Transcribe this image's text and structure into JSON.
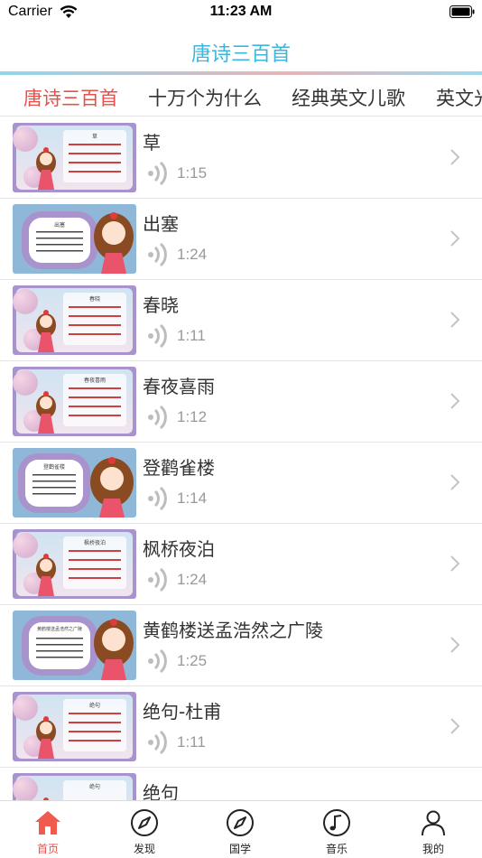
{
  "status_bar": {
    "carrier": "Carrier",
    "time": "11:23 AM"
  },
  "nav": {
    "title": "唐诗三百首"
  },
  "tabs": [
    {
      "label": "唐诗三百首",
      "active": true
    },
    {
      "label": "十万个为什么",
      "active": false
    },
    {
      "label": "经典英文儿歌",
      "active": false
    },
    {
      "label": "英文光",
      "active": false
    }
  ],
  "list": [
    {
      "title": "草",
      "duration": "1:15",
      "thumb_caption": "草"
    },
    {
      "title": "出塞",
      "duration": "1:24",
      "thumb_caption": "出塞"
    },
    {
      "title": "春晓",
      "duration": "1:11",
      "thumb_caption": "春晓"
    },
    {
      "title": "春夜喜雨",
      "duration": "1:12",
      "thumb_caption": "春夜喜雨"
    },
    {
      "title": "登鹳雀楼",
      "duration": "1:14",
      "thumb_caption": "登鹳雀楼"
    },
    {
      "title": "枫桥夜泊",
      "duration": "1:24",
      "thumb_caption": "枫桥夜泊"
    },
    {
      "title": "黄鹤楼送孟浩然之广陵",
      "duration": "1:25",
      "thumb_caption": "黄鹤楼送孟浩然之广陵"
    },
    {
      "title": "绝句-杜甫",
      "duration": "1:11",
      "thumb_caption": "绝句"
    },
    {
      "title": "绝句",
      "duration": "",
      "thumb_caption": "绝句"
    }
  ],
  "bottom_tabs": [
    {
      "label": "首页",
      "icon": "home-icon",
      "active": true
    },
    {
      "label": "发现",
      "icon": "compass-icon",
      "active": false
    },
    {
      "label": "国学",
      "icon": "compass-icon",
      "active": false
    },
    {
      "label": "音乐",
      "icon": "music-note-icon",
      "active": false
    },
    {
      "label": "我的",
      "icon": "user-icon",
      "active": false
    }
  ],
  "colors": {
    "accent": "#e8504a",
    "title": "#3cb6dc",
    "thumb_frame": "#9b86c4"
  }
}
